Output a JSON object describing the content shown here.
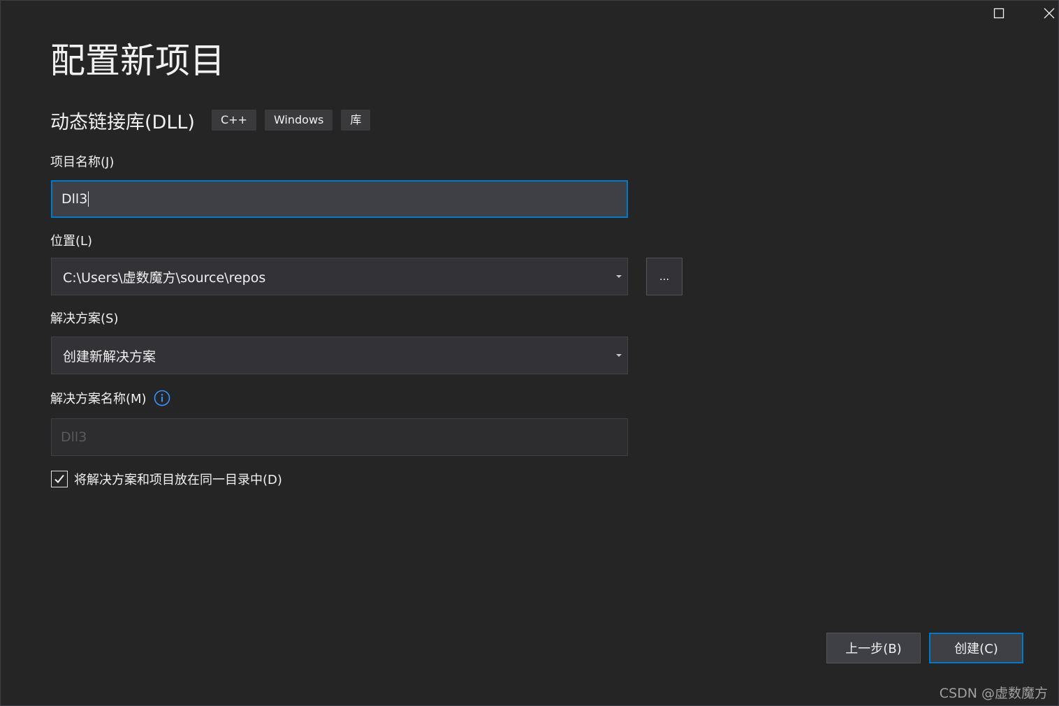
{
  "window": {
    "maximize_icon": "maximize-icon",
    "close_icon": "close-icon"
  },
  "page": {
    "title": "配置新项目",
    "template_name": "动态链接库(DLL)",
    "tags": [
      "C++",
      "Windows",
      "库"
    ]
  },
  "fields": {
    "project_name": {
      "label": "项目名称(J)",
      "value": "Dll3"
    },
    "location": {
      "label": "位置(L)",
      "value": "C:\\Users\\虚数魔方\\source\\repos",
      "browse_label": "..."
    },
    "solution": {
      "label": "解决方案(S)",
      "value": "创建新解决方案"
    },
    "solution_name": {
      "label": "解决方案名称(M)",
      "value": "Dll3",
      "info_icon": "info-icon"
    },
    "same_directory": {
      "label": "将解决方案和项目放在同一目录中(D)",
      "checked": true
    }
  },
  "buttons": {
    "back": "上一步(B)",
    "create": "创建(C)"
  },
  "watermark": "CSDN @虚数魔方",
  "colors": {
    "background": "#252526",
    "accent": "#007acc",
    "input_bg": "#333337",
    "text": "#f1f1f1"
  }
}
